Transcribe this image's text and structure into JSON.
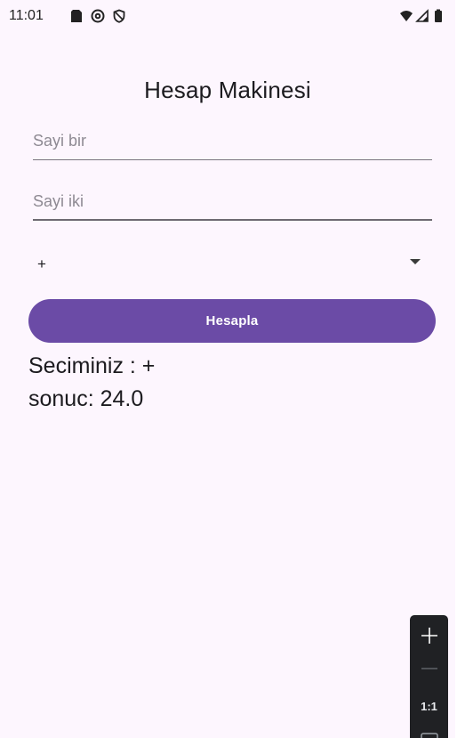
{
  "status_bar": {
    "time": "11:01",
    "icons_left": [
      "sd-card-icon",
      "at-sign-icon",
      "shield-icon"
    ],
    "icons_right": [
      "wifi-icon",
      "signal-icon",
      "battery-icon"
    ]
  },
  "app": {
    "title": "Hesap Makinesi",
    "input_one": {
      "placeholder": "Sayi bir",
      "value": ""
    },
    "input_two": {
      "placeholder": "Sayi iki",
      "value": ""
    },
    "operator_select": {
      "selected": "+"
    },
    "calculate_button": "Hesapla",
    "selection_text": "Seciminiz : +",
    "result_text": "sonuc: 24.0"
  },
  "zoom_control": {
    "reset_label": "1:1"
  },
  "colors": {
    "background": "#fdf6fe",
    "primary": "#6b4ba6",
    "text": "#1c1b1f",
    "underline": "#79747e"
  }
}
